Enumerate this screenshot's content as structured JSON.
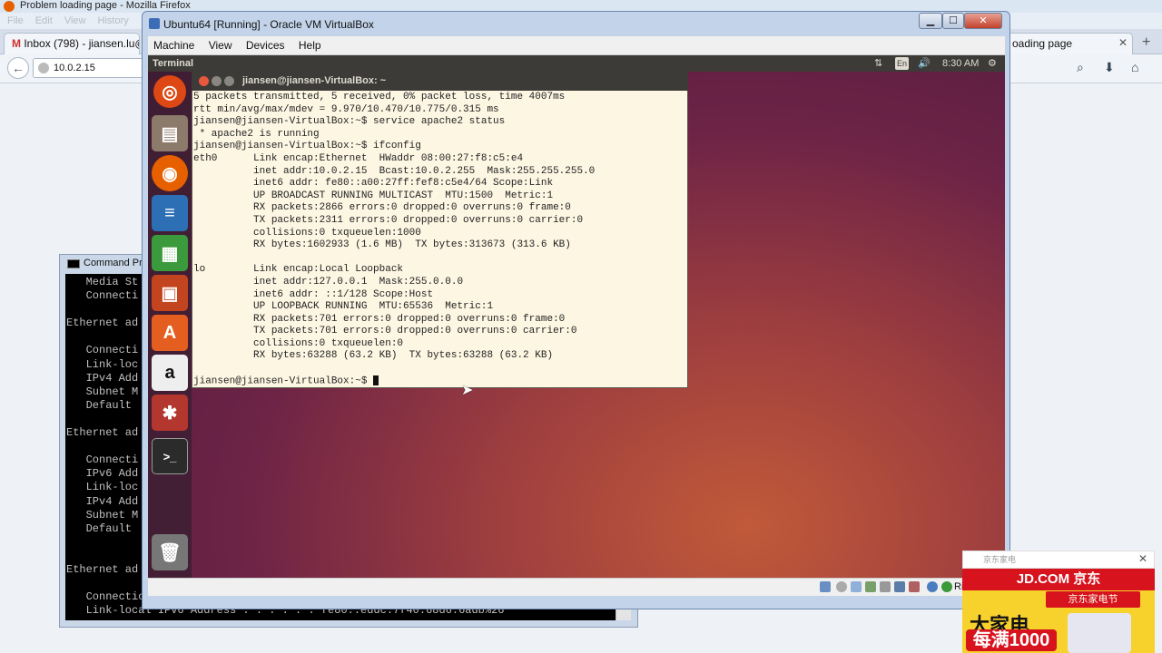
{
  "firefox": {
    "window_title": "Problem loading page - Mozilla Firefox",
    "menu": [
      "File",
      "Edit",
      "View",
      "History"
    ],
    "tabs": [
      {
        "label": "Inbox (798) - jiansen.lu@g"
      },
      {
        "label": "oading page"
      }
    ],
    "url": "10.0.2.15"
  },
  "cmd": {
    "title": "Command Pr",
    "lines": [
      "   Media St",
      "   Connecti",
      "",
      "Ethernet ad",
      "",
      "   Connecti",
      "   Link-loc",
      "   IPv4 Add",
      "   Subnet M",
      "   Default ",
      "",
      "Ethernet ad",
      "",
      "   Connecti",
      "   IPv6 Add",
      "   Link-loc",
      "   IPv4 Add",
      "   Subnet M",
      "   Default ",
      "",
      "",
      "Ethernet ad",
      "",
      "   Connection-specific DNS Suffix  . :",
      "   Link-local IPv6 Address . . . . . : fe80::eddc:7f40:68d6:6adb%26"
    ]
  },
  "vbox": {
    "title": "Ubuntu64 [Running] - Oracle VM VirtualBox",
    "menu": [
      "Machine",
      "View",
      "Devices",
      "Help"
    ],
    "status_right": "Ri"
  },
  "ubuntu": {
    "topbar_app": "Terminal",
    "lang": "En",
    "clock": "8:30 AM"
  },
  "terminal": {
    "title": "jiansen@jiansen-VirtualBox: ~",
    "lines": [
      "5 packets transmitted, 5 received, 0% packet loss, time 4007ms",
      "rtt min/avg/max/mdev = 9.970/10.470/10.775/0.315 ms",
      "jiansen@jiansen-VirtualBox:~$ service apache2 status",
      " * apache2 is running",
      "jiansen@jiansen-VirtualBox:~$ ifconfig",
      "eth0      Link encap:Ethernet  HWaddr 08:00:27:f8:c5:e4  ",
      "          inet addr:10.0.2.15  Bcast:10.0.2.255  Mask:255.255.255.0",
      "          inet6 addr: fe80::a00:27ff:fef8:c5e4/64 Scope:Link",
      "          UP BROADCAST RUNNING MULTICAST  MTU:1500  Metric:1",
      "          RX packets:2866 errors:0 dropped:0 overruns:0 frame:0",
      "          TX packets:2311 errors:0 dropped:0 overruns:0 carrier:0",
      "          collisions:0 txqueuelen:1000 ",
      "          RX bytes:1602933 (1.6 MB)  TX bytes:313673 (313.6 KB)",
      "",
      "lo        Link encap:Local Loopback  ",
      "          inet addr:127.0.0.1  Mask:255.0.0.0",
      "          inet6 addr: ::1/128 Scope:Host",
      "          UP LOOPBACK RUNNING  MTU:65536  Metric:1",
      "          RX packets:701 errors:0 dropped:0 overruns:0 frame:0",
      "          TX packets:701 errors:0 dropped:0 overruns:0 carrier:0",
      "          collisions:0 txqueuelen:0 ",
      "          RX bytes:63288 (63.2 KB)  TX bytes:63288 (63.2 KB)",
      "",
      "jiansen@jiansen-VirtualBox:~$ "
    ]
  },
  "ad": {
    "header": "京东家电",
    "brand": "JD.COM 京东",
    "badge": "京东家电节",
    "headline": "大家电",
    "promo": "每满1000"
  },
  "colors": {
    "ubuntu_orange": "#dd4814",
    "terminal_bg": "#fdf6e3",
    "jd_red": "#d7131e"
  }
}
